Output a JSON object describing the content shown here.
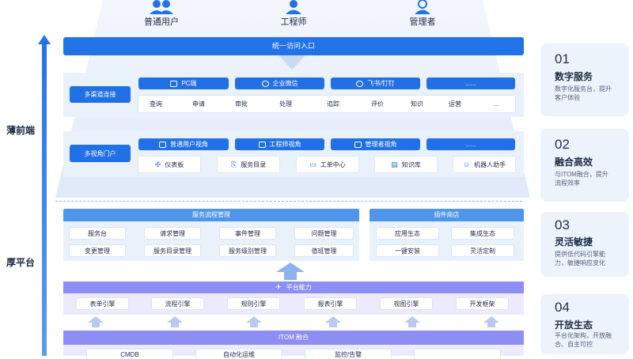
{
  "users": [
    "普通用户",
    "工程师",
    "管理者"
  ],
  "entry": "统一访问入口",
  "side_labels": {
    "front": "薄前端",
    "platform": "厚平台"
  },
  "channels": {
    "label": "多渠道连接",
    "pills": [
      "PC端",
      "企业微信",
      "飞书/钉钉",
      "......"
    ],
    "actions": [
      "查询",
      "申请",
      "审批",
      "处理",
      "追踪",
      "评价",
      "知识",
      "运营",
      "..."
    ]
  },
  "portals": {
    "label": "多视角门户",
    "pills": [
      "普通用户视角",
      "工程师视角",
      "管理者视角",
      "......"
    ],
    "items": [
      "仪表板",
      "服务目录",
      "工单中心",
      "知识库",
      "机器人助手"
    ]
  },
  "service_flow": {
    "title": "服务流程管理",
    "items": [
      "服务台",
      "请求管理",
      "事件管理",
      "问题管理",
      "变更管理",
      "服务目录管理",
      "服务级别管理",
      "值班管理"
    ]
  },
  "plugin_store": {
    "title": "插件商店",
    "items": [
      "应用生态",
      "集成生态",
      "一键安装",
      "灵活定制"
    ]
  },
  "platform_capability": {
    "title": "平台能力",
    "engines": [
      "表单引擎",
      "流程引擎",
      "规则引擎",
      "报表引擎",
      "视图引擎",
      "开发框架"
    ]
  },
  "itom": {
    "title": "ITOM 融合",
    "items": [
      "CMDB",
      "自动化运维",
      "监控/告警",
      ""
    ]
  },
  "cards": [
    {
      "num": "01",
      "title": "数字服务",
      "desc": "数字化服务台，提升客户体验"
    },
    {
      "num": "02",
      "title": "融合高效",
      "desc": "与ITOM融合，提升流程效率"
    },
    {
      "num": "03",
      "title": "灵活敏捷",
      "desc": "提供低代码引擎能力，敏捷响应变化"
    },
    {
      "num": "04",
      "title": "开放生态",
      "desc": "平台化架构，开放融合、自主可控"
    }
  ],
  "colors": {
    "primary": "#2272e8",
    "panel": "#e9f1fb",
    "header": "#4f95ea",
    "platform": "#8d8ef3"
  }
}
